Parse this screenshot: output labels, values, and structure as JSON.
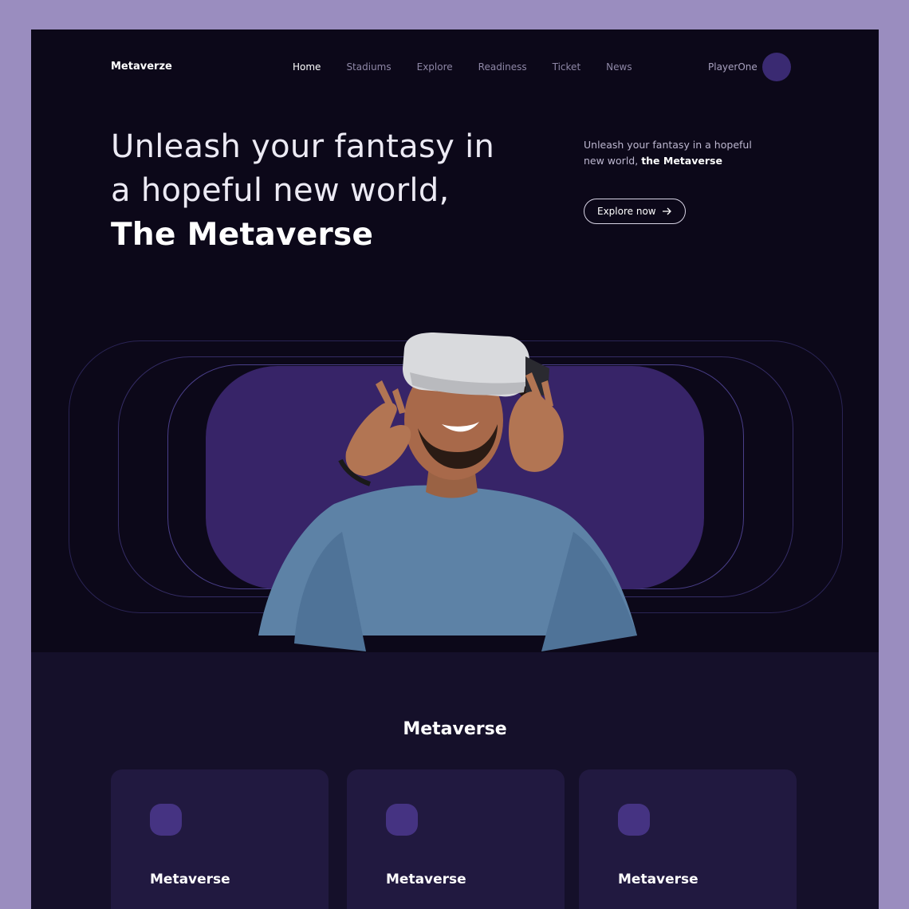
{
  "nav": {
    "logo": "Metaverze",
    "items": [
      {
        "label": "Home",
        "active": true
      },
      {
        "label": "Stadiums"
      },
      {
        "label": "Explore"
      },
      {
        "label": "Readiness"
      },
      {
        "label": "Ticket"
      },
      {
        "label": "News"
      }
    ],
    "user": "PlayerOne"
  },
  "hero": {
    "title_line1": "Unleash your fantasy in",
    "title_line2": "a hopeful new world,",
    "title_line3": "The Metaverse",
    "sub_text": "Unleash your fantasy in a hopeful new world,",
    "sub_bold": "the Metaverse",
    "button_label": "Explore now",
    "button_icon": "arrow-right-icon"
  },
  "section": {
    "title": "Metaverse",
    "cards": [
      {
        "label": "Metaverse"
      },
      {
        "label": "Metaverse"
      },
      {
        "label": "Metaverse"
      }
    ]
  },
  "colors": {
    "background": "#0c0819",
    "accent": "#372468",
    "outer": "#9a8dbf"
  }
}
